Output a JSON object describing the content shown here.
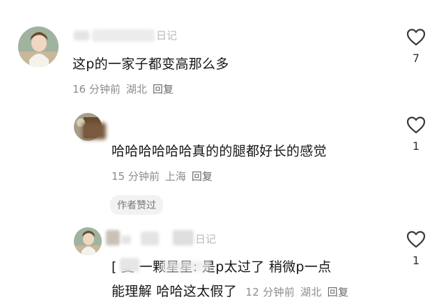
{
  "comments": [
    {
      "name_visible": "日记",
      "body": "这p的一家子都变高那么多",
      "time": "16 分钟前",
      "location": "湖北",
      "reply_label": "回复",
      "likes": "7"
    },
    {
      "body": "哈哈哈哈哈哈真的的腿都好长的感觉",
      "time": "15 分钟前",
      "location": "上海",
      "reply_label": "回复",
      "likes": "1",
      "badge": "作者赞过"
    },
    {
      "name_visible": "日记",
      "body_line1": "[ 复 一颗星星: 是p太过了 稍微p一点",
      "body_line2": "能理解 哈哈这太假了",
      "time": "12 分钟前",
      "location": "湖北",
      "reply_label": "回复",
      "likes": "1"
    }
  ]
}
